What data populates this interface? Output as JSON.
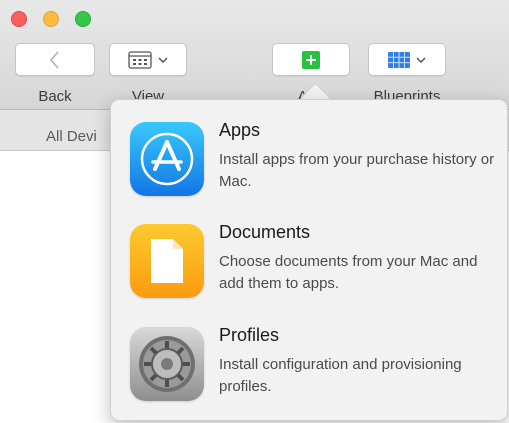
{
  "toolbar": {
    "back_label": "Back",
    "view_label": "View",
    "add_label": "Add",
    "blueprints_label": "Blueprints"
  },
  "tabs": {
    "all_devices_label": "All Devi"
  },
  "menu": {
    "items": [
      {
        "title": "Apps",
        "description": "Install apps from your purchase history or Mac.",
        "icon": "app-store-icon"
      },
      {
        "title": "Documents",
        "description": "Choose documents from your Mac and add them to apps.",
        "icon": "document-icon"
      },
      {
        "title": "Profiles",
        "description": "Install configuration and provisioning profiles.",
        "icon": "settings-gear-icon"
      }
    ]
  },
  "colors": {
    "add_button_green": "#27c23f",
    "blueprints_blue": "#2f7fe8"
  }
}
